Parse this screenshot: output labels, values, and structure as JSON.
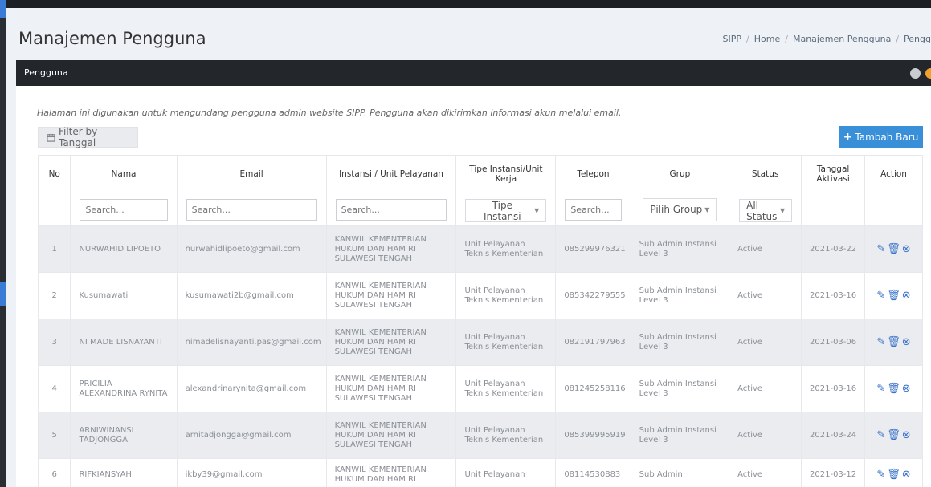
{
  "page": {
    "title": "Manajemen Pengguna",
    "breadcrumb": [
      "SIPP",
      "Home",
      "Manajemen Pengguna",
      "Pengg"
    ]
  },
  "panel": {
    "title": "Pengguna",
    "description": "Halaman ini digunakan untuk mengundang pengguna admin website SIPP. Pengguna akan dikirimkan informasi akun melalui email.",
    "filter_label": "Filter by Tanggal",
    "add_label": "Tambah Baru"
  },
  "table": {
    "columns": [
      "No",
      "Nama",
      "Email",
      "Instansi / Unit Pelayanan",
      "Tipe Instansi/Unit Kerja",
      "Telepon",
      "Grup",
      "Status",
      "Tanggal Aktivasi",
      "Action"
    ],
    "filters": {
      "nama_placeholder": "Search...",
      "email_placeholder": "Search...",
      "instansi_placeholder": "Search...",
      "tipe_selected": "Tipe Instansi",
      "telepon_placeholder": "Search...",
      "grup_selected": "Pilih Group",
      "status_selected": "All Status"
    },
    "rows": [
      {
        "no": "1",
        "nama": "NURWAHID LIPOETO",
        "email": "nurwahidlipoeto@gmail.com",
        "instansi": "KANWIL KEMENTERIAN HUKUM DAN HAM RI SULAWESI TENGAH",
        "tipe": "Unit Pelayanan Teknis Kementerian",
        "telepon": "085299976321",
        "grup": "Sub Admin Instansi Level 3",
        "status": "Active",
        "tanggal": "2021-03-22"
      },
      {
        "no": "2",
        "nama": "Kusumawati",
        "email": "kusumawati2b@gmail.com",
        "instansi": "KANWIL KEMENTERIAN HUKUM DAN HAM RI SULAWESI TENGAH",
        "tipe": "Unit Pelayanan Teknis Kementerian",
        "telepon": "085342279555",
        "grup": "Sub Admin Instansi Level 3",
        "status": "Active",
        "tanggal": "2021-03-16"
      },
      {
        "no": "3",
        "nama": "NI MADE LISNAYANTI",
        "email": "nimadelisnayanti.pas@gmail.com",
        "instansi": "KANWIL KEMENTERIAN HUKUM DAN HAM RI SULAWESI TENGAH",
        "tipe": "Unit Pelayanan Teknis Kementerian",
        "telepon": "082191797963",
        "grup": "Sub Admin Instansi Level 3",
        "status": "Active",
        "tanggal": "2021-03-06"
      },
      {
        "no": "4",
        "nama": "PRICILIA ALEXANDRINA RYNITA",
        "email": "alexandrinarynita@gmail.com",
        "instansi": "KANWIL KEMENTERIAN HUKUM DAN HAM RI SULAWESI TENGAH",
        "tipe": "Unit Pelayanan Teknis Kementerian",
        "telepon": "081245258116",
        "grup": "Sub Admin Instansi Level 3",
        "status": "Active",
        "tanggal": "2021-03-16"
      },
      {
        "no": "5",
        "nama": "ARNIWINANSI TADJONGGA",
        "email": "arnitadjongga@gmail.com",
        "instansi": "KANWIL KEMENTERIAN HUKUM DAN HAM RI SULAWESI TENGAH",
        "tipe": "Unit Pelayanan Teknis Kementerian",
        "telepon": "085399995919",
        "grup": "Sub Admin Instansi Level 3",
        "status": "Active",
        "tanggal": "2021-03-24"
      },
      {
        "no": "6",
        "nama": "RIFKIANSYAH",
        "email": "ikby39@gmail.com",
        "instansi": "KANWIL KEMENTERIAN HUKUM DAN HAM RI",
        "tipe": "Unit Pelayanan",
        "telepon": "08114530883",
        "grup": "Sub Admin",
        "status": "Active",
        "tanggal": "2021-03-12"
      }
    ]
  },
  "icons": {
    "edit": "edit-icon",
    "delete": "trash-icon",
    "remove": "close-circle-icon",
    "calendar": "calendar-icon",
    "plus": "plus-icon"
  },
  "colors": {
    "accent": "#3a8fd9",
    "panel_header": "#23272c",
    "action_icon": "#3a73c9",
    "stripe": "#eaecef"
  }
}
